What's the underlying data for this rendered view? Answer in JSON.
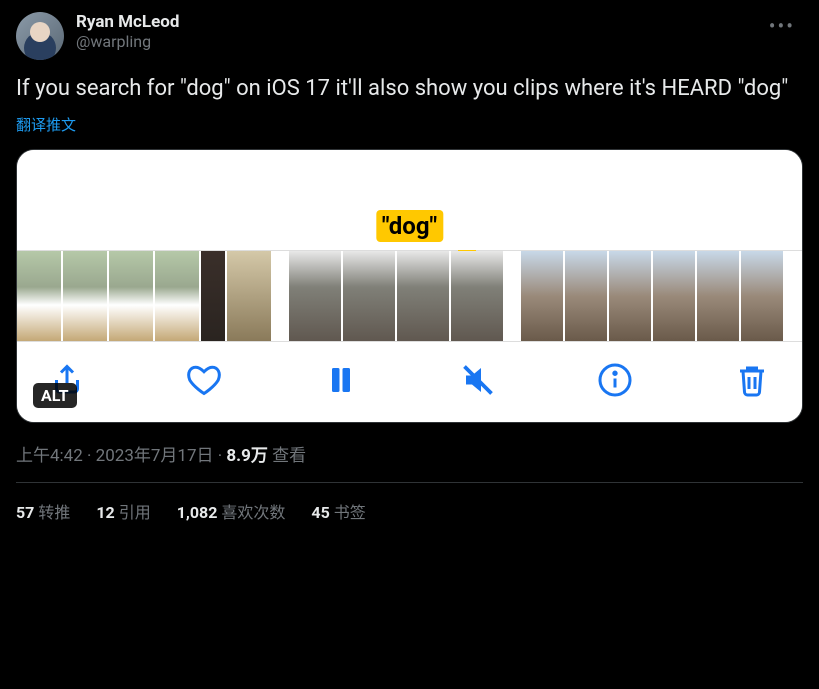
{
  "user": {
    "display_name": "Ryan McLeod",
    "handle": "@warpling"
  },
  "tweet_text": "If you search for \"dog\" on iOS 17 it'll also show you clips where it's HEARD \"dog\"",
  "translate_label": "翻译推文",
  "media": {
    "tag_label": "\"dog\"",
    "alt_badge": "ALT"
  },
  "meta": {
    "time": "上午4:42",
    "date": "2023年7月17日",
    "views_number": "8.9万",
    "views_label": "查看"
  },
  "stats": {
    "retweets_num": "57",
    "retweets_label": "转推",
    "quotes_num": "12",
    "quotes_label": "引用",
    "likes_num": "1,082",
    "likes_label": "喜欢次数",
    "bookmarks_num": "45",
    "bookmarks_label": "书签"
  }
}
